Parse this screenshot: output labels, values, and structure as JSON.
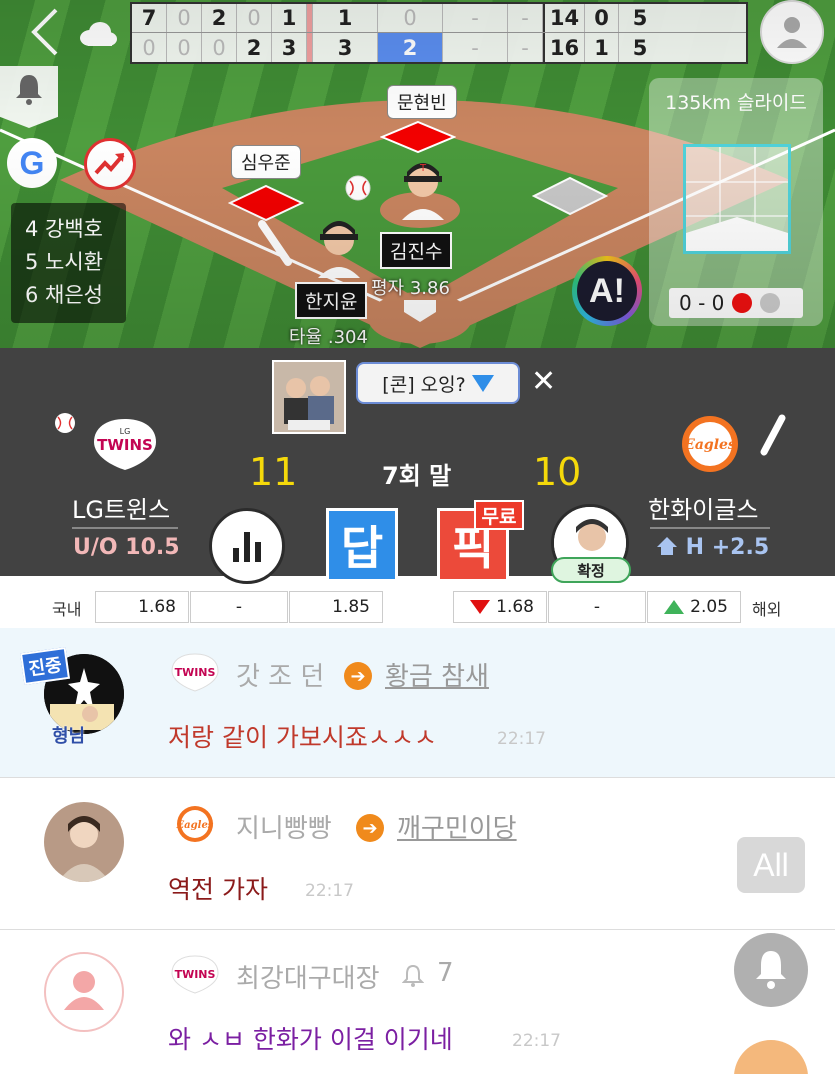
{
  "scoreboard": {
    "away": [
      "7",
      "0",
      "2",
      "0",
      "1",
      "1",
      "0",
      "-",
      "-"
    ],
    "home": [
      "0",
      "0",
      "0",
      "2",
      "3",
      "3",
      "2",
      "-",
      "-"
    ],
    "away_totals": [
      "14",
      "0",
      "5"
    ],
    "home_totals": [
      "16",
      "1",
      "5"
    ]
  },
  "lineup": [
    "4 강백호",
    "5 노시환",
    "6 채은성"
  ],
  "bases": {
    "second": "문현빈",
    "first": "심우준"
  },
  "batter": {
    "name": "한지윤",
    "stat": "타율 .304"
  },
  "pitcher": {
    "name": "김진수",
    "stat": "평자 3.86"
  },
  "pitch": {
    "info": "135km 슬라이드",
    "count": "0 - 0"
  },
  "chat_room": {
    "label": "[콘] 오잉?"
  },
  "game": {
    "away_team": "LG트윈스",
    "home_team": "한화이글스",
    "away_score": "11",
    "home_score": "10",
    "inning": "7회 말",
    "uo": "U/O 10.5",
    "handicap": "H +2.5",
    "away_logo": "TWINS",
    "home_logo": "Eagles"
  },
  "actions": {
    "dap": "답",
    "pick": "픽",
    "free": "무료",
    "confirm": "확정"
  },
  "odds": {
    "domestic_label": "국내",
    "overseas_label": "해외",
    "domestic": [
      "1.68",
      "-",
      "1.85"
    ],
    "overseas": [
      "1.68",
      "-",
      "2.05"
    ]
  },
  "messages": [
    {
      "badge": "진중",
      "sub": "형님",
      "team": "TWINS",
      "user": "갓 조 던",
      "target": "황금 참새",
      "text": "저랑 같이 가보시죠ㅅㅅㅅ",
      "time": "22:17",
      "color": "#c0392b"
    },
    {
      "team": "Eagles",
      "user": "지니빵빵",
      "target": "깨구민이당",
      "text": "역전 가자",
      "time": "22:17",
      "color": "#8b1a1a"
    },
    {
      "team": "TWINS",
      "user": "최강대구대장",
      "level": "7",
      "text": "와 ㅅㅂ 한화가 이걸 이기네",
      "time": "22:17",
      "color": "#7b1fa2"
    }
  ],
  "all_button": "All",
  "icons": [
    "back-icon",
    "cloud-icon",
    "bell-icon",
    "google-icon",
    "trend-icon",
    "profile-icon",
    "baseball-icon",
    "bat-icon",
    "dropdown-icon",
    "close-icon",
    "bar-chart-icon",
    "arrow-right-icon"
  ]
}
